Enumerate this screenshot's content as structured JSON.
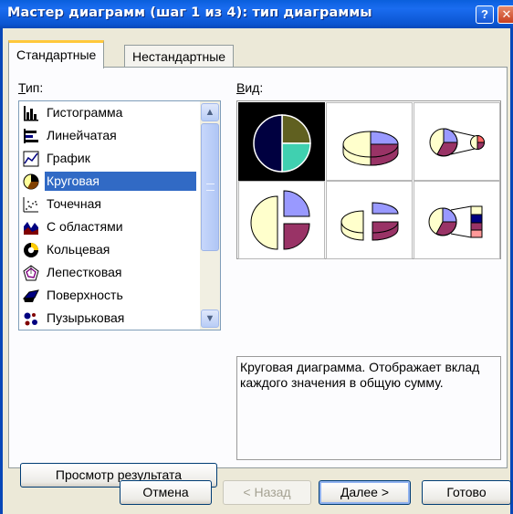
{
  "window": {
    "title": "Мастер диаграмм (шаг 1 из 4): тип диаграммы",
    "help_btn": "?",
    "close_btn": "✕"
  },
  "tabs": [
    {
      "label": "Стандартные",
      "active": true
    },
    {
      "label": "Нестандартные",
      "active": false
    }
  ],
  "type_label": "Тип:",
  "view_label": "Вид:",
  "chart_types": [
    {
      "label": "Гистограмма",
      "icon": "histogram-icon"
    },
    {
      "label": "Линейчатая",
      "icon": "bar-chart-icon"
    },
    {
      "label": "График",
      "icon": "line-chart-icon"
    },
    {
      "label": "Круговая",
      "icon": "pie-chart-icon",
      "selected": true
    },
    {
      "label": "Точечная",
      "icon": "scatter-chart-icon"
    },
    {
      "label": "С областями",
      "icon": "area-chart-icon"
    },
    {
      "label": "Кольцевая",
      "icon": "doughnut-chart-icon"
    },
    {
      "label": "Лепестковая",
      "icon": "radar-chart-icon"
    },
    {
      "label": "Поверхность",
      "icon": "surface-chart-icon"
    },
    {
      "label": "Пузырьковая",
      "icon": "bubble-chart-icon"
    }
  ],
  "description": "Круговая диаграмма. Отображает вклад каждого значения в общую сумму.",
  "preview_button": "Просмотр результата",
  "buttons": {
    "cancel": "Отмена",
    "back": "< Назад",
    "next": "Далее >",
    "finish": "Готово"
  },
  "colors": {
    "title_bar": "#0b55d1",
    "selection": "#316ac5",
    "pie_slice_1": "#9999ff",
    "pie_slice_2": "#993366",
    "pie_slice_3": "#ffffcc",
    "selected_slice_1": "#000040",
    "selected_slice_2": "#606020",
    "selected_slice_3": "#40d0b0"
  }
}
